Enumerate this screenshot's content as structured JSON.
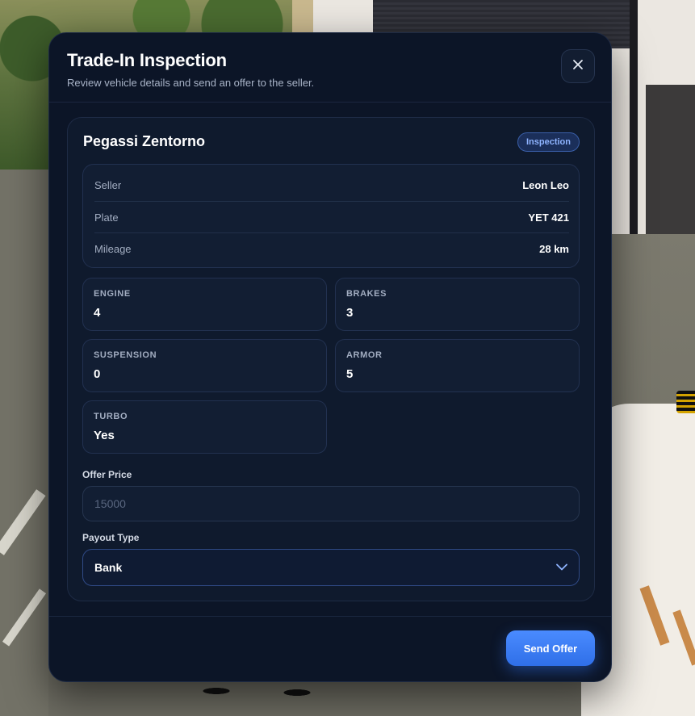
{
  "modal": {
    "title": "Trade-In Inspection",
    "subtitle": "Review vehicle details and send an offer to the seller."
  },
  "vehicle": {
    "name": "Pegassi Zentorno",
    "status": "Inspection",
    "details": [
      {
        "label": "Seller",
        "value": "Leon Leo"
      },
      {
        "label": "Plate",
        "value": "YET 421"
      },
      {
        "label": "Mileage",
        "value": "28 km"
      }
    ]
  },
  "stats": {
    "engine": {
      "label": "ENGINE",
      "value": "4"
    },
    "brakes": {
      "label": "BRAKES",
      "value": "3"
    },
    "suspension": {
      "label": "SUSPENSION",
      "value": "0"
    },
    "armor": {
      "label": "ARMOR",
      "value": "5"
    },
    "turbo": {
      "label": "TURBO",
      "value": "Yes"
    }
  },
  "offer": {
    "label": "Offer Price",
    "placeholder": "15000",
    "value": ""
  },
  "payout": {
    "label": "Payout Type",
    "selected": "Bank"
  },
  "footer": {
    "send_label": "Send Offer"
  },
  "icons": {
    "close": "close-icon",
    "dropdown": "chevron-down-icon"
  },
  "colors": {
    "accent": "#3b7cf5",
    "badge_text": "#8fb4ff",
    "modal_bg": "#0c1527"
  }
}
